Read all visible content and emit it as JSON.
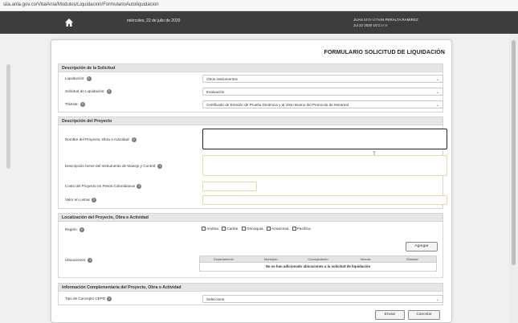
{
  "browser": {
    "url": "siia.anla.gov.co/VitalAnla/Modulos/Liquidacion/FormularioAutoliquidacion"
  },
  "header": {
    "date": "miércoles, 22 de julio de 2020",
    "user_label": "Usuario:",
    "user_name": "JUAN SEBASTIAN PERALTA RAMIREZ",
    "last_access_label": "Último Acceso:",
    "last_access": "Jul 22 2020 10:33AM"
  },
  "page_title": "FORMULARIO SOLICITUD DE LIQUIDACIÓN",
  "solicitud": {
    "title": "Descripción de la Solicitud",
    "liquidacion_label": "Liquidación:",
    "liquidacion_value": "Otros instrumentos",
    "solicitud_label": "Solicitud de Liquidación:",
    "solicitud_value": "Evaluación",
    "tramite_label": "Trámite:",
    "tramite_value": "Certificado de Emisión de Prueba Dinámica y al Visto Bueno del Protocolo de Montreal"
  },
  "proyecto": {
    "title": "Descripción del Proyecto",
    "nombre_label": "Nombre del Proyecto, Obra o Actividad:",
    "nombre_value": "",
    "descripcion_label": "Descripción breve del Instrumento de Manejo y Control:",
    "descripcion_value": "",
    "costo_label": "Costo del Proyecto en Pesos Colombianos",
    "costo_value": "",
    "valor_label": "Valor en Letras",
    "valor_value": ""
  },
  "localizacion": {
    "title": "Localización del Proyecto, Obra o Actividad",
    "region_label": "Región:",
    "regions": [
      "Andina",
      "Caribe",
      "Orinoquia",
      "Amazonia",
      "Pacífica"
    ],
    "agregar": "Agregar",
    "ubicaciones_label": "Ubicaciones:",
    "columns": [
      "Departamento",
      "Municipio",
      "Corregimiento",
      "Vereda",
      "Eliminar"
    ],
    "empty_text": "No se han adicionado ubicaciones a la solicitud de liquidación"
  },
  "complementaria": {
    "title": "Información Complementaria del Proyecto, Obra o Actividad",
    "tipo_label": "Tipo de Concepto CEPD",
    "tipo_value": "Seleccione"
  },
  "actions": {
    "enviar": "Enviar",
    "cancelar": "Cancelar"
  },
  "colors": {
    "topbar": "#3d3d3d",
    "section_head": "#e6e6e6",
    "border": "#d6d6d6"
  }
}
